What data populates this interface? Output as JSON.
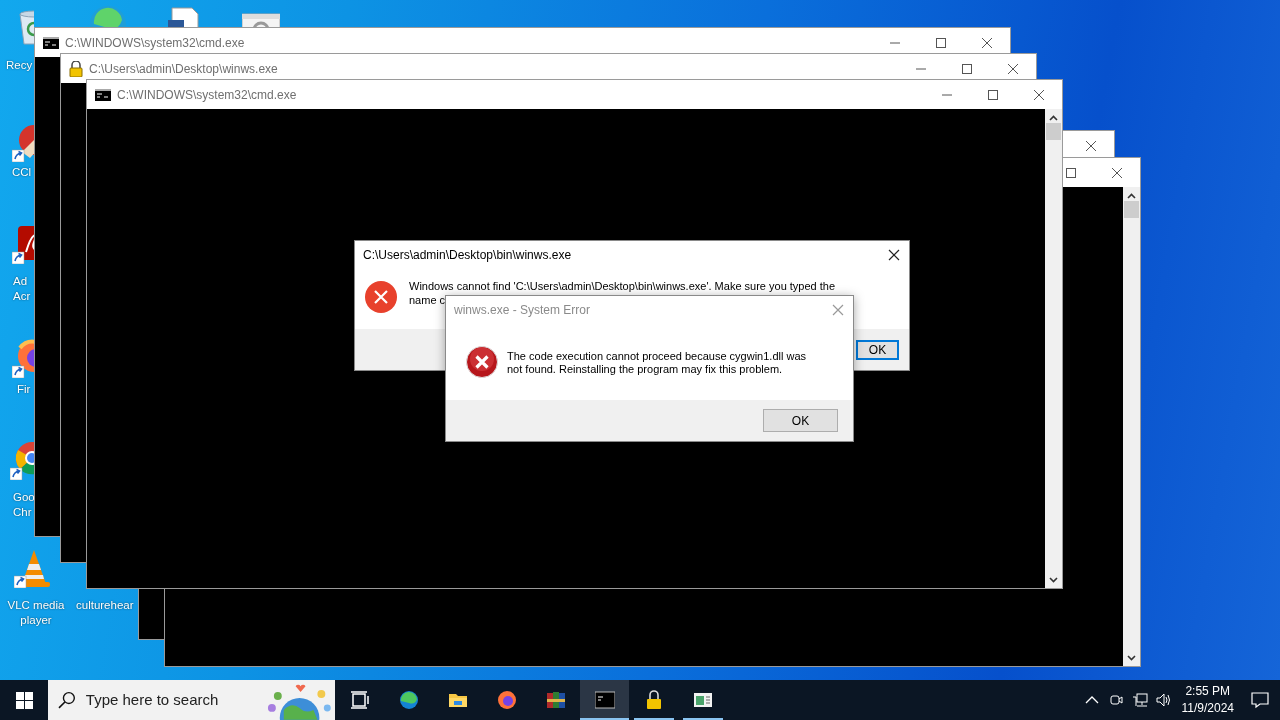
{
  "desktop_icons": [
    {
      "label": "Recy"
    },
    {
      "label": "CCl"
    },
    {
      "label": "Ad Acr"
    },
    {
      "label": "Fir"
    },
    {
      "label": "Goo Chr"
    },
    {
      "label": "VLC media player"
    },
    {
      "label": "culturehear"
    }
  ],
  "windows": [
    {
      "kind": "console"
    },
    {
      "kind": "console"
    },
    {
      "kind": "console",
      "title": "C:\\WINDOWS\\system32\\cmd.exe"
    },
    {
      "kind": "console",
      "title": "C:\\Users\\admin\\Desktop\\winws.exe"
    },
    {
      "kind": "console",
      "title": "C:\\WINDOWS\\system32\\cmd.exe"
    }
  ],
  "dialogs": [
    {
      "title": "C:\\Users\\admin\\Desktop\\bin\\winws.exe",
      "message_lines": [
        "Windows cannot find 'C:\\Users\\admin\\Desktop\\bin\\winws.exe'. Make sure you typed the",
        "name c"
      ],
      "buttons": [
        {
          "label": "OK",
          "default": true
        }
      ]
    },
    {
      "title": "winws.exe - System Error",
      "message_lines": [
        "The code execution cannot proceed because cygwin1.dll was",
        "not found. Reinstalling the program may fix this problem."
      ],
      "buttons": [
        {
          "label": "OK",
          "default": false
        }
      ]
    }
  ],
  "taskbar": {
    "search": {
      "placeholder": "Type here to search"
    },
    "apps": [
      {
        "running": false,
        "selected": false
      },
      {
        "running": false,
        "selected": false
      },
      {
        "running": false,
        "selected": false
      },
      {
        "running": false,
        "selected": false
      },
      {
        "running": false,
        "selected": false
      },
      {
        "running": true,
        "selected": true
      },
      {
        "running": true,
        "selected": false
      },
      {
        "running": true,
        "selected": false
      }
    ],
    "clock": {
      "time": "2:55 PM",
      "date": "11/9/2024"
    }
  }
}
